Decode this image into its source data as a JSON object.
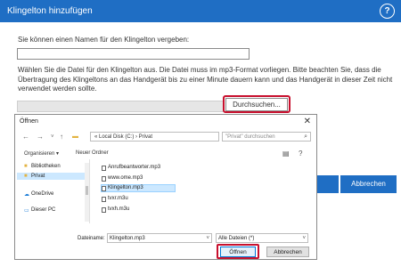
{
  "header": {
    "title": "Klingelton hinzufügen",
    "help_icon": "?"
  },
  "form": {
    "name_prompt": "Sie können einen Namen für den Klingelton vergeben:",
    "name_value": "",
    "instructions": "Wählen Sie die Datei für den Klingelton aus. Die Datei muss im mp3-Format vorliegen. Bitte beachten Sie, dass die Übertragung des Klingeltons an das Handgerät bis zu einer Minute dauern kann und das Handgerät in dieser Zeit nicht verwendet werden sollte.",
    "browse_label": "Durchsuchen...",
    "cancel_label": "Abbrechen"
  },
  "file_dialog": {
    "title": "Öffnen",
    "close_glyph": "✕",
    "nav": {
      "back": "←",
      "forward": "→",
      "down": "˅",
      "up": "↑"
    },
    "address": "« Local Disk (C:) › Privat",
    "search_placeholder": "\"Privat\" durchsuchen",
    "toolbar": {
      "organize": "Organisieren ▾",
      "new_folder": "Neuer Ordner"
    },
    "sidebar": [
      {
        "label": "Bibliotheken"
      },
      {
        "label": "Privat"
      },
      {
        "label": "OneDrive"
      },
      {
        "label": "Dieser PC"
      }
    ],
    "files": [
      {
        "name": "Anrufbeantworter.mp3"
      },
      {
        "name": "www.ome.mp3"
      },
      {
        "name": "Klingelton.mp3"
      },
      {
        "name": "tvxr.m3u"
      },
      {
        "name": "tvxh.m3u"
      }
    ],
    "filename_label": "Dateiname:",
    "filename_value": "Klingelton.mp3",
    "type_value": "Alle Dateien (*)",
    "open_label": "Öffnen",
    "cancel_label": "Abbrechen"
  },
  "colors": {
    "header_blue": "#1f6ec4",
    "highlight_red": "#c8102e"
  }
}
